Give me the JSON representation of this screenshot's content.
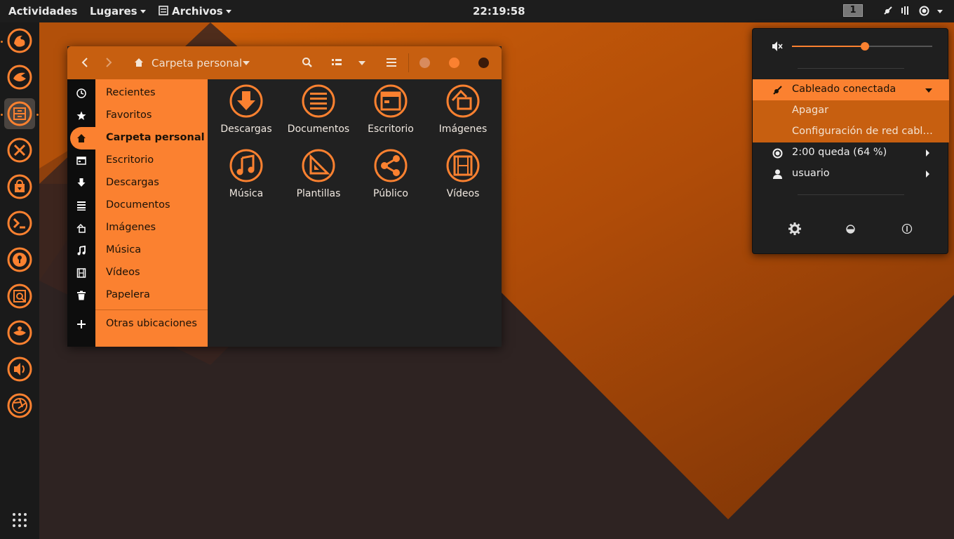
{
  "topbar": {
    "activities": "Actividades",
    "places": "Lugares",
    "app_menu": "Archivos",
    "clock": "22:19:58",
    "workspace": "1"
  },
  "dock": {
    "items": [
      "firefox-icon",
      "thunderbird-icon",
      "files-icon",
      "tools-icon",
      "software-store-icon",
      "terminal-icon",
      "keyring-icon",
      "image-viewer-icon",
      "gimp-icon",
      "sound-icon",
      "aperture-icon"
    ],
    "active_index": 2
  },
  "filemanager": {
    "path_label": "Carpeta personal",
    "sidebar": [
      {
        "label": "Recientes",
        "icon": "clock-icon"
      },
      {
        "label": "Favoritos",
        "icon": "star-icon"
      },
      {
        "label": "Carpeta personal",
        "icon": "home-icon",
        "active": true
      },
      {
        "label": "Escritorio",
        "icon": "desktop-icon"
      },
      {
        "label": "Descargas",
        "icon": "download-icon"
      },
      {
        "label": "Documentos",
        "icon": "documents-icon"
      },
      {
        "label": "Imágenes",
        "icon": "pictures-icon"
      },
      {
        "label": "Música",
        "icon": "music-icon"
      },
      {
        "label": "Vídeos",
        "icon": "videos-icon"
      },
      {
        "label": "Papelera",
        "icon": "trash-icon"
      }
    ],
    "other_locations": "Otras ubicaciones",
    "folders": [
      {
        "label": "Descargas",
        "icon": "download-folder-icon"
      },
      {
        "label": "Documentos",
        "icon": "documents-folder-icon"
      },
      {
        "label": "Escritorio",
        "icon": "desktop-folder-icon"
      },
      {
        "label": "Imágenes",
        "icon": "pictures-folder-icon"
      },
      {
        "label": "Música",
        "icon": "music-folder-icon"
      },
      {
        "label": "Plantillas",
        "icon": "templates-folder-icon"
      },
      {
        "label": "Público",
        "icon": "public-folder-icon"
      },
      {
        "label": "Vídeos",
        "icon": "videos-folder-icon"
      }
    ]
  },
  "system_menu": {
    "volume_level": 0.52,
    "network": "Cableado conectada",
    "network_off": "Apagar",
    "network_settings": "Configuración de red cabl…",
    "battery": "2:00 queda (64 %)",
    "user": "usuario"
  },
  "colors": {
    "accent": "#fb8130",
    "accent_dark": "#c75f10",
    "panel": "#1d1d1d"
  }
}
